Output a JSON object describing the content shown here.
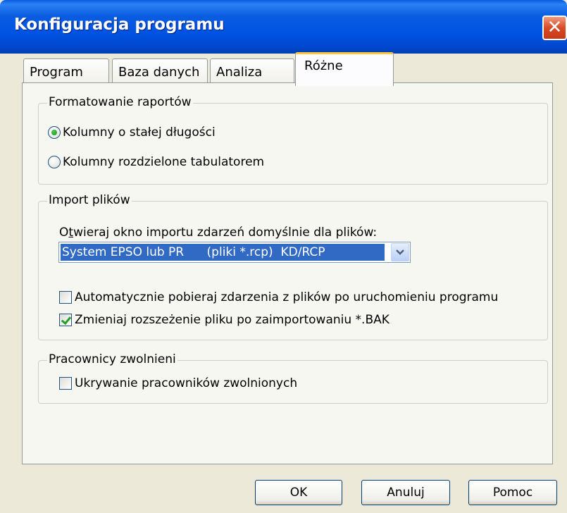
{
  "window": {
    "title": "Konfiguracja programu",
    "close_glyph": "✕"
  },
  "tabs": [
    {
      "label": "Program"
    },
    {
      "label": "Baza danych"
    },
    {
      "label": "Analiza"
    },
    {
      "label": "Różne",
      "selected": true
    }
  ],
  "groups": {
    "report_format": {
      "legend": "Formatowanie raportów",
      "options": [
        {
          "label": "Kolumny o stałej długości",
          "checked": true
        },
        {
          "label": "Kolumny rozdzielone tabulatorem",
          "checked": false
        }
      ]
    },
    "file_import": {
      "legend": "Import plików",
      "combo_label_first": "O",
      "combo_label_mnemonic": "t",
      "combo_label_rest": "wieraj okno importu zdarzeń domyślnie dla plików:",
      "combo_value": "System EPSO lub PR      (pliki *.rcp)  KD/RCP",
      "checks": [
        {
          "label": "Automatycznie pobieraj zdarzenia z plików po uruchomieniu programu",
          "checked": false
        },
        {
          "label": "Zmieniaj rozszeżenie pliku po zaimportowaniu *.BAK",
          "checked": true
        }
      ]
    },
    "dismissed": {
      "legend": "Pracownicy zwolnieni",
      "checks": [
        {
          "label": "Ukrywanie pracowników zwolnionych",
          "checked": false
        }
      ]
    }
  },
  "buttons": {
    "ok": "OK",
    "cancel": "Anuluj",
    "help": "Pomoc"
  },
  "colors": {
    "titlebar": "#0054e3",
    "selection": "#316ac5",
    "active_tab_accent": "#ffc83c"
  }
}
